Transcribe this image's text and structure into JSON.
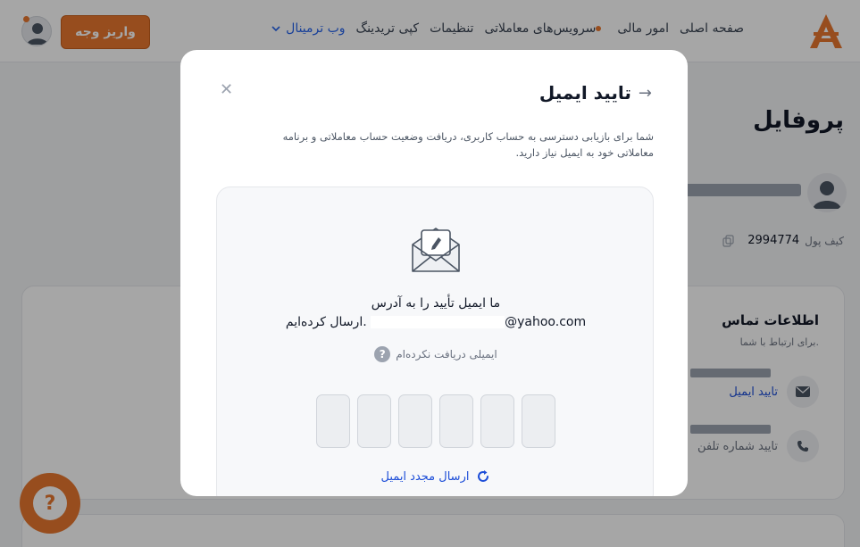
{
  "topbar": {
    "nav": [
      {
        "label": "صفحه اصلی"
      },
      {
        "label": "امور مالی"
      },
      {
        "label": "سرویس‌های معاملاتی"
      },
      {
        "label": "تنظیمات"
      },
      {
        "label": "کپی تریدینگ"
      },
      {
        "label": "وب ترمینال"
      }
    ],
    "deposit_label": "واریز وجه",
    "accent": "#e8772e"
  },
  "profile": {
    "title": "پروفایل",
    "wallet_label": "کیف پول",
    "wallet_id": "2994774"
  },
  "contact": {
    "title": "اطلاعات تماس",
    "subtitle": "برای ارتباط با شما.",
    "verify_email": "تایید ایمیل",
    "verify_phone": "تایید شماره تلفن"
  },
  "modal": {
    "title": "تایید ایمیل",
    "description": "شما برای بازیابی دسترسی به حساب کاربری، دریافت وضعیت حساب معاملاتی و برنامه معاملاتی خود به ایمیل نیاز دارید.",
    "sent_line1": "ما ایمیل تأیید را به آدرس",
    "email_domain": "@yahoo.com",
    "sent_suffix": "ارسال کرده‌ایم.",
    "not_received": "ایمیلی دریافت نکرده‌ام",
    "resend": "ارسال مجدد ایمیل",
    "code_length": 6
  },
  "icons": {
    "close": "close-icon",
    "back": "arrow-right-icon",
    "envelope": "envelope-icon",
    "help": "help-icon",
    "refresh": "refresh-icon"
  }
}
